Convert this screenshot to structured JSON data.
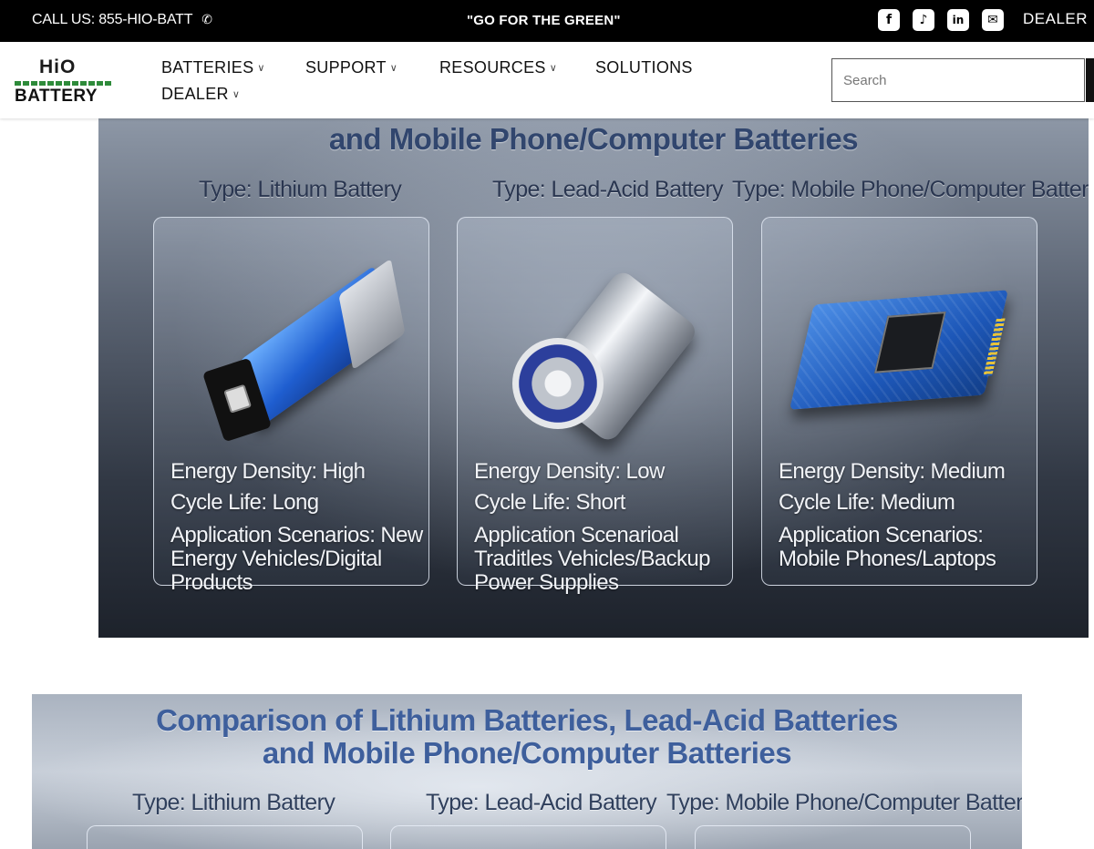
{
  "topbar": {
    "call_text": "CALL US: 855-HIO-BATT",
    "phone_icon": "phone-icon",
    "slogan": "\"GO FOR THE GREEN\"",
    "social_icons": [
      {
        "name": "facebook-icon",
        "glyph": "f"
      },
      {
        "name": "tiktok-icon",
        "glyph": "♪"
      },
      {
        "name": "linkedin-icon",
        "glyph": "in"
      },
      {
        "name": "email-icon",
        "glyph": "✉"
      }
    ],
    "dealer_link": "DEALER"
  },
  "header": {
    "logo": {
      "top": "HiO",
      "bottom": "BATTERY"
    },
    "nav": [
      {
        "label": "BATTERIES",
        "has_dropdown": true
      },
      {
        "label": "SUPPORT",
        "has_dropdown": true
      },
      {
        "label": "RESOURCES",
        "has_dropdown": true
      },
      {
        "label": "SOLUTIONS",
        "has_dropdown": false
      },
      {
        "label": "DEALER",
        "has_dropdown": true
      }
    ],
    "search_placeholder": "Search",
    "dropdown_icon": "chevron-down-icon"
  },
  "infographic1": {
    "title": "and Mobile Phone/Computer Batteries",
    "columns": [
      {
        "type": "Type: Lithium Battery",
        "energy_density": "Energy Density: High",
        "cycle_life": "Cycle Life: Long",
        "application": "Application Scenarios: New Energy Vehicles/Digital Products"
      },
      {
        "type": "Type: Lead-Acid Battery",
        "energy_density": "Energy Density: Low",
        "cycle_life": "Cycle Life: Short",
        "application": "Application Scenarioal Traditles Vehicles/Backup Power Supplies"
      },
      {
        "type": "Type: Mobile Phone/Computer Battery",
        "energy_density": "Energy Density: Medium",
        "cycle_life": "Cycle Life: Medium",
        "application": "Application Scenarios: Mobile Phones/Laptops"
      }
    ]
  },
  "infographic2": {
    "title_line1": "Comparison of Lithium Batteries, Lead-Acid Batteries",
    "title_line2": "and Mobile Phone/Computer Batteries",
    "types": [
      "Type: Lithium Battery",
      "Type: Lead-Acid Battery",
      "Type: Mobile Phone/Computer Battery"
    ]
  },
  "colors": {
    "topbar_bg": "#000000",
    "brand_green": "#2e8b3a",
    "title_blue": "#3e5f9c"
  }
}
